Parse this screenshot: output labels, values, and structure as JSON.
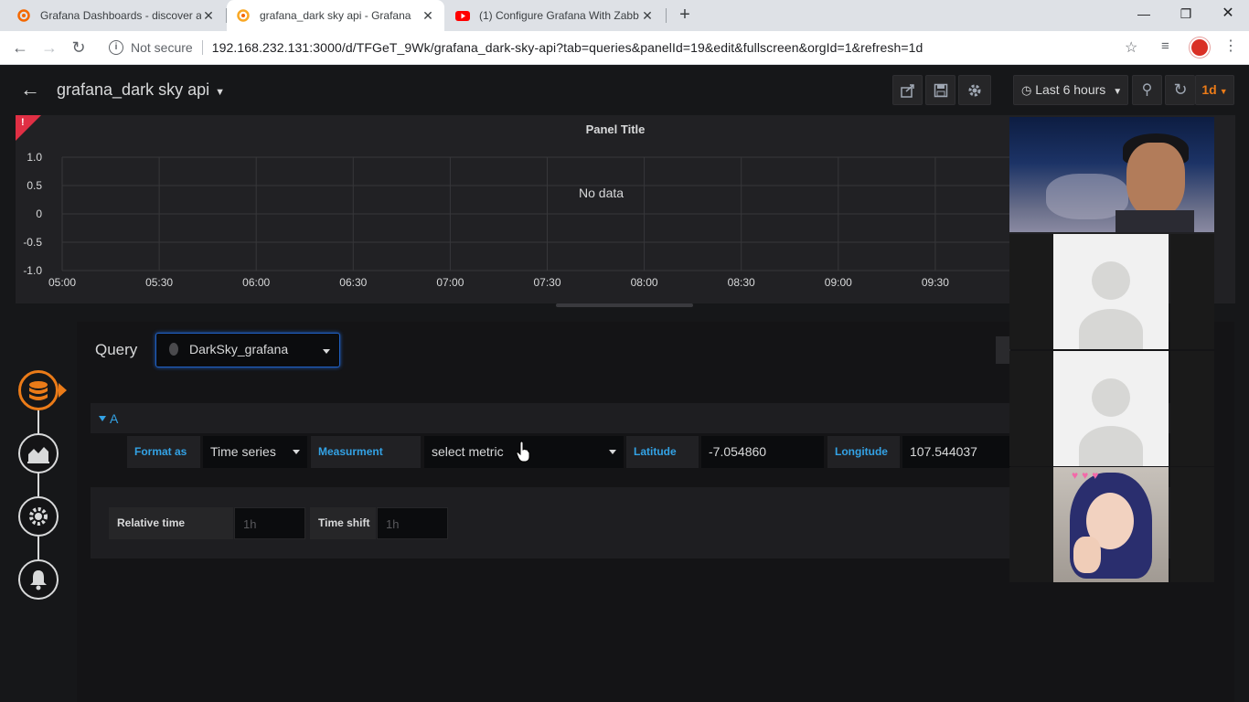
{
  "browser": {
    "tabs": [
      {
        "title": "Grafana Dashboards - discover an",
        "active": false
      },
      {
        "title": "grafana_dark sky api - Grafana",
        "active": true
      },
      {
        "title": "(1) Configure Grafana With Zabb",
        "active": false
      }
    ],
    "new_tab": "+",
    "address": {
      "security": "Not secure",
      "url": "192.168.232.131:3000/d/TFGeT_9Wk/grafana_dark-sky-api?tab=queries&panelId=19&edit&fullscreen&orgId=1&refresh=1d"
    }
  },
  "dashboard": {
    "title": "grafana_dark sky api",
    "time_range": "Last 6 hours",
    "refresh_interval": "1d"
  },
  "panel": {
    "title": "Panel Title",
    "no_data": "No data",
    "alert_mark": "!"
  },
  "chart_data": {
    "type": "line",
    "title": "Panel Title",
    "yticks": [
      "1.0",
      "0.5",
      "0",
      "-0.5",
      "-1.0"
    ],
    "ylim": [
      -1.0,
      1.0
    ],
    "xticks": [
      "05:00",
      "05:30",
      "06:00",
      "06:30",
      "07:00",
      "07:30",
      "08:00",
      "08:30",
      "09:00",
      "09:30"
    ],
    "series": [],
    "grid": true
  },
  "query": {
    "label": "Query",
    "datasource": "DarkSky_grafana",
    "ref_id": "A",
    "fields": {
      "format_as_label": "Format as",
      "format_as_value": "Time series",
      "measurement_label": "Measurment",
      "measurement_value": "select metric",
      "latitude_label": "Latitude",
      "latitude_value": "-7.054860",
      "longitude_label": "Longitude",
      "longitude_value": "107.544037"
    },
    "options": {
      "relative_time_label": "Relative time",
      "relative_time_placeholder": "1h",
      "time_shift_label": "Time shift",
      "time_shift_placeholder": "1h"
    }
  },
  "colors": {
    "accent": "#eb7b18",
    "link_blue": "#33a2e5",
    "alert_red": "#e02f44",
    "panel_bg": "#212124",
    "page_bg": "#161719"
  }
}
